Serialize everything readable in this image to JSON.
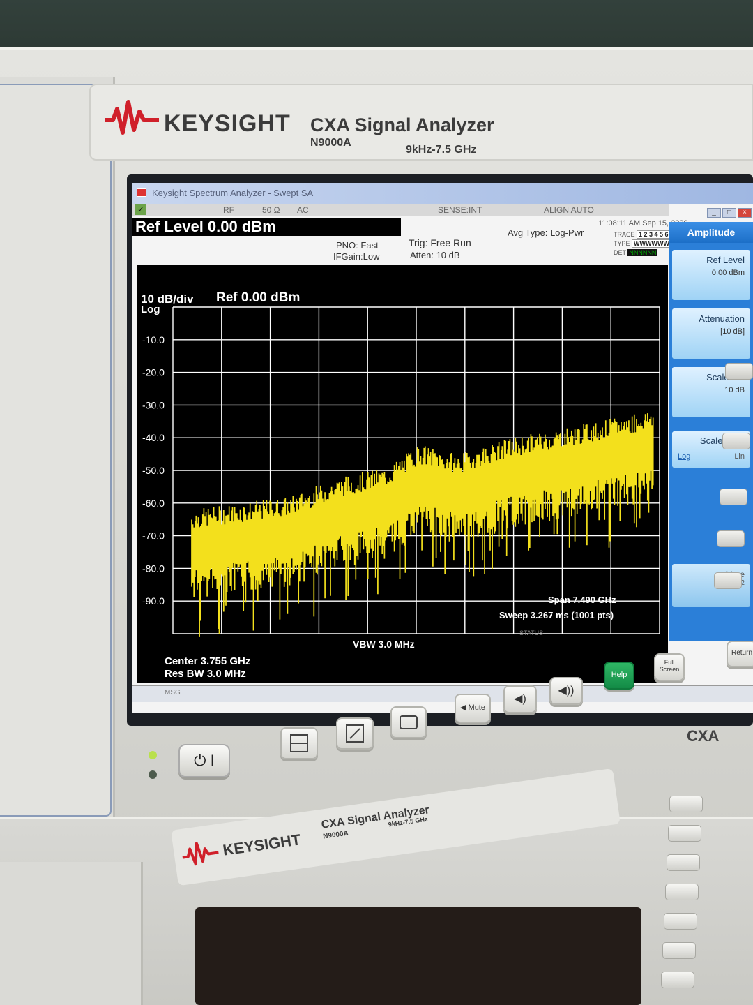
{
  "instrument": {
    "brand": "KEYSIGHT",
    "model_title": "CXA Signal Analyzer",
    "model_number": "N9000A",
    "freq_range": "9kHz-7.5 GHz",
    "cxa_badge": "CXA"
  },
  "window": {
    "title": "Keysight Spectrum Analyzer - Swept SA"
  },
  "status_row": {
    "rf": "RF",
    "impedance": "50 Ω",
    "coupling": "AC",
    "sense": "SENSE:INT",
    "align": "ALIGN AUTO",
    "datetime": "11:08:11 AM Sep 15, 2020"
  },
  "header": {
    "ref_level": "Ref Level 0.00 dBm",
    "pno": "PNO: Fast",
    "ifgain": "IFGain:Low",
    "trig": "Trig: Free Run",
    "atten": "Atten: 10 dB",
    "avg_type": "Avg Type: Log-Pwr",
    "trace_label": "TRACE",
    "trace_nums": "1 2 3 4 5 6",
    "type_label": "TYPE",
    "type_vals": "WWWWWW",
    "det_label": "DET",
    "det_vals": "NNNNNN"
  },
  "plot": {
    "scale_label": "10 dB/div",
    "scale_type": "Log",
    "ref_label": "Ref 0.00 dBm",
    "y_ticks": [
      "-10.0",
      "-20.0",
      "-30.0",
      "-40.0",
      "-50.0",
      "-60.0",
      "-70.0",
      "-80.0",
      "-90.0"
    ],
    "center": "Center 3.755 GHz",
    "res_bw": "Res BW 3.0 MHz",
    "vbw": "VBW 3.0 MHz",
    "span": "Span 7.490 GHz",
    "sweep": "Sweep  3.267 ms (1001 pts)",
    "status": "STATUS"
  },
  "softkeys": {
    "title": "Amplitude",
    "ref_level": "Ref Level",
    "ref_level_val": "0.00 dBm",
    "attenuation": "Attenuation",
    "attenuation_val": "[10 dB]",
    "scale_div": "Scale/Div",
    "scale_div_val": "10 dB",
    "scale_type": "Scale Type",
    "scale_type_log": "Log",
    "scale_type_lin": "Lin",
    "more": "More",
    "more_page": "1 of 2"
  },
  "msg": {
    "label": "MSG"
  },
  "front_buttons": {
    "mute": "Mute",
    "help": "Help",
    "full_screen": "Full Screen",
    "return": "Return"
  },
  "colors": {
    "trace": "#f3e01c",
    "grid": "#ffffff",
    "softkey_blue": "#2b7fd8"
  },
  "chart_data": {
    "type": "line",
    "title": "",
    "xlabel": "",
    "ylabel": "",
    "ylim": [
      -100,
      0
    ],
    "x_range_ghz": [
      0.01,
      7.5
    ],
    "series": [
      {
        "x_ghz": [
          0.3,
          1.0,
          1.8,
          2.6,
          3.3,
          3.8,
          4.4,
          5.2,
          6.0,
          6.8,
          7.4
        ],
        "values": [
          -74,
          -72,
          -70,
          -64,
          -61,
          -54,
          -57,
          -52,
          -49,
          -46,
          -43
        ]
      }
    ]
  }
}
